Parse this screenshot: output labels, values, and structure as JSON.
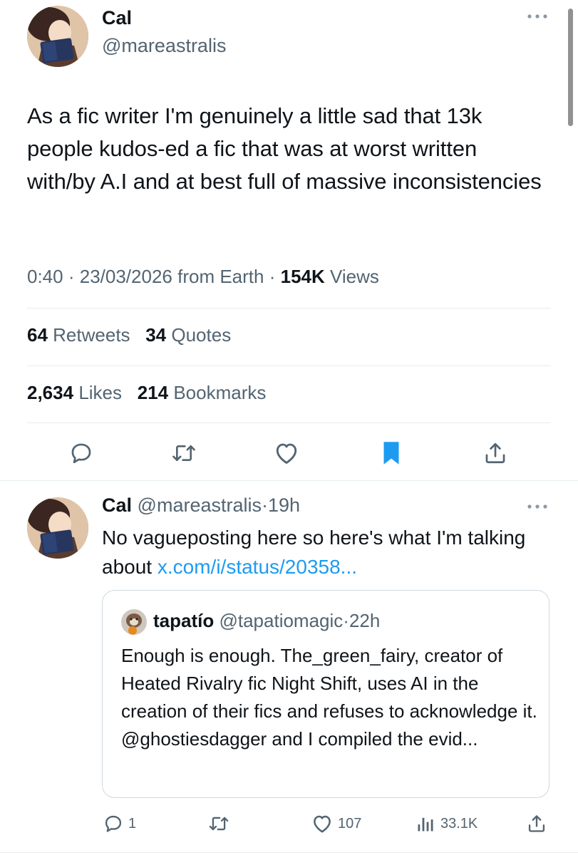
{
  "main_tweet": {
    "author_name": "Cal",
    "handle": "@mareastralis",
    "text": "As a fic writer I'm genuinely a little sad that 13k people kudos-ed a fic that was at worst written with/by A.I and at best full of massive inconsistencies",
    "time": "0:40",
    "date": "23/03/2026",
    "source": "from Earth",
    "views_count": "154K",
    "views_label": "Views",
    "retweets_count": "64",
    "retweets_label": "Retweets",
    "quotes_count": "34",
    "quotes_label": "Quotes",
    "likes_count": "2,634",
    "likes_label": "Likes",
    "bookmarks_count": "214",
    "bookmarks_label": "Bookmarks"
  },
  "actions": [
    "reply-icon",
    "retweet-icon",
    "like-icon",
    "bookmark-icon",
    "share-icon"
  ],
  "reply": {
    "author_name": "Cal",
    "handle": "@mareastralis",
    "age": "19h",
    "text": "No vagueposting here so here's what I'm talking about ",
    "link_text": "x.com/i/status/20358...",
    "quoted": {
      "author_name": "tapatío",
      "handle": "@tapatiomagic",
      "age": "22h",
      "text": "Enough is enough. The_green_fairy, creator of Heated Rivalry fic Night Shift, uses AI in the creation of their fics and refuses to acknowledge it. @ghostiesdagger and I compiled the evid..."
    },
    "reply_count": "1",
    "like_count": "107",
    "view_count": "33.1K"
  },
  "colors": {
    "text": "#0f1419",
    "muted": "#536471",
    "link": "#1d9bf0",
    "bookmark_active": "#1d9bf0",
    "divider": "#e6ecf0"
  }
}
